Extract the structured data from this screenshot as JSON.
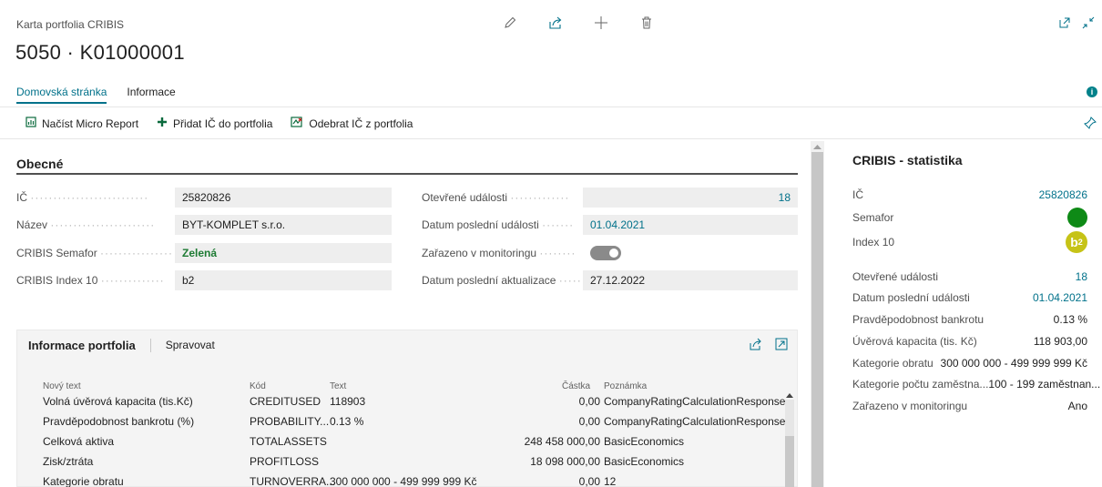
{
  "header": {
    "breadcrumb": "Karta portfolia CRIBIS",
    "title": "5050 · K01000001"
  },
  "tabs": [
    {
      "label": "Domovská stránka",
      "active": true
    },
    {
      "label": "Informace",
      "active": false
    }
  ],
  "actions": [
    {
      "label": "Načíst Micro Report",
      "icon": "report-icon"
    },
    {
      "label": "Přidat IČ do portfolia",
      "icon": "plus-icon"
    },
    {
      "label": "Odebrat IČ z portfolia",
      "icon": "remove-icon"
    }
  ],
  "general": {
    "section_title": "Obecné",
    "left": [
      {
        "label": "IČ",
        "value": "25820826"
      },
      {
        "label": "Název",
        "value": "BYT-KOMPLET s.r.o."
      },
      {
        "label": "CRIBIS Semafor",
        "value": "Zelená"
      },
      {
        "label": "CRIBIS Index 10",
        "value": "b2"
      }
    ],
    "right": [
      {
        "label": "Otevřené události",
        "value": "18"
      },
      {
        "label": "Datum poslední události",
        "value": "01.04.2021"
      },
      {
        "label": "Zařazeno v monitoringu",
        "value_on": true
      },
      {
        "label": "Datum poslední aktualizace",
        "value": "27.12.2022"
      }
    ]
  },
  "portfolio": {
    "title": "Informace portfolia",
    "manage_label": "Spravovat",
    "columns": [
      "Nový text",
      "Kód",
      "Text",
      "Částka",
      "Poznámka"
    ],
    "rows": [
      [
        "Volná úvěrová kapacita (tis.Kč)",
        "CREDITUSED",
        "118903",
        "0,00",
        "CompanyRatingCalculationResponse"
      ],
      [
        "Pravděpodobnost bankrotu (%)",
        "PROBABILITY...",
        "0.13 %",
        "0,00",
        "CompanyRatingCalculationResponse"
      ],
      [
        "Celková aktiva",
        "TOTALASSETS",
        "",
        "248 458 000,00",
        "BasicEconomics"
      ],
      [
        "Zisk/ztráta",
        "PROFITLOSS",
        "",
        "18 098 000,00",
        "BasicEconomics"
      ],
      [
        "Kategorie obratu",
        "TURNOVERRA...",
        "300 000 000 - 499 999 999 Kč",
        "0,00",
        "12"
      ]
    ]
  },
  "factbox": {
    "title": "CRIBIS - statistika",
    "ic_label": "IČ",
    "ic_value": "25820826",
    "semafor_label": "Semafor",
    "semafor_color": "#0e8a16",
    "index_label": "Index 10",
    "index_value": "b",
    "index_sub": "2",
    "stats": [
      {
        "label": "Otevřené události",
        "value": "18",
        "link": true
      },
      {
        "label": "Datum poslední události",
        "value": "01.04.2021",
        "link": true
      },
      {
        "label": "Pravděpodobnost bankrotu",
        "value": "0.13 %",
        "link": false
      },
      {
        "label": "Úvěrová kapacita (tis. Kč)",
        "value": "118 903,00",
        "link": false
      },
      {
        "label": "Kategorie obratu",
        "value": "300 000 000 - 499 999 999 Kč",
        "link": false
      },
      {
        "label": "Kategorie počtu zaměstna...",
        "value": "100 - 199 zaměstnan...",
        "link": false
      },
      {
        "label": "Zařazeno v monitoringu",
        "value": "Ano",
        "link": false
      }
    ]
  },
  "colors": {
    "accent": "#00718a",
    "semafor_green": "#0e8a16",
    "index_badge": "#c6c317"
  }
}
